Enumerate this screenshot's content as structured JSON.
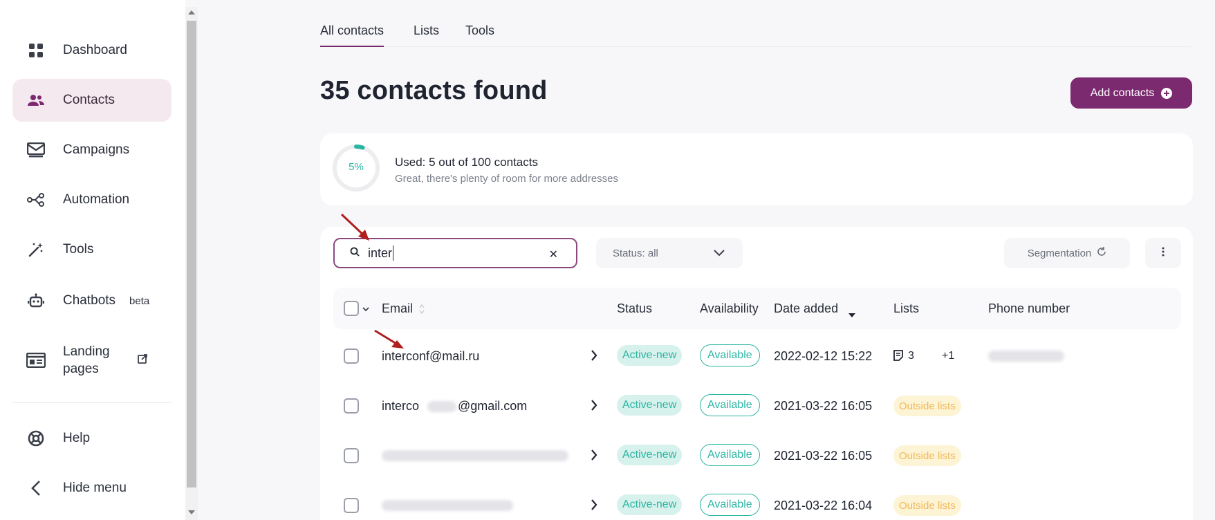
{
  "sidebar": {
    "items": [
      {
        "label": "Dashboard",
        "icon": "dashboard-grid-icon"
      },
      {
        "label": "Contacts",
        "icon": "contacts-icon",
        "active": true
      },
      {
        "label": "Campaigns",
        "icon": "campaigns-envelope-icon"
      },
      {
        "label": "Automation",
        "icon": "automation-flow-icon"
      },
      {
        "label": "Tools",
        "icon": "magic-wand-icon"
      },
      {
        "label": "Chatbots",
        "icon": "robot-icon",
        "badge": "beta"
      },
      {
        "label": "Landing\npages",
        "icon": "landing-page-icon",
        "external_icon": "external-link-icon"
      },
      {
        "label": "Help",
        "icon": "help-lifebuoy-icon"
      },
      {
        "label": "Hide menu",
        "icon": "chevron-left-icon"
      }
    ]
  },
  "tabs": [
    "All contacts",
    "Lists",
    "Tools"
  ],
  "page_title": "35 contacts found",
  "add_contacts_label": "Add contacts",
  "usage": {
    "percent_label": "5%",
    "used_fraction": 0.05,
    "main": "Used: 5 out of 100 contacts",
    "sub": "Great, there's plenty of room for more addresses"
  },
  "search": {
    "value": "inter"
  },
  "status_filter": "Status: all",
  "segmentation_label": "Segmentation",
  "columns": {
    "email": "Email",
    "status": "Status",
    "availability": "Availability",
    "date_added": "Date added",
    "lists": "Lists",
    "phone": "Phone number"
  },
  "rows": [
    {
      "email_prefix": "interconf@mail.ru",
      "email_suffix": "",
      "status": "Active-new",
      "availability": "Available",
      "date": "2022-02-12 15:22",
      "lists_count": "3",
      "lists_extra": "+1"
    },
    {
      "email_prefix": "interco",
      "email_suffix": "@gmail.com",
      "status": "Active-new",
      "availability": "Available",
      "date": "2021-03-22 16:05",
      "lists_badge": "Outside lists"
    },
    {
      "status": "Active-new",
      "availability": "Available",
      "date": "2021-03-22 16:05",
      "lists_badge": "Outside lists"
    },
    {
      "status": "Active-new",
      "availability": "Available",
      "date": "2021-03-22 16:04",
      "lists_badge": "Outside lists"
    }
  ],
  "colors": {
    "brand": "#7b2a70",
    "accent": "#2bb5a3",
    "warning": "#f0b85a",
    "annotation_arrow": "#b01e1e"
  }
}
